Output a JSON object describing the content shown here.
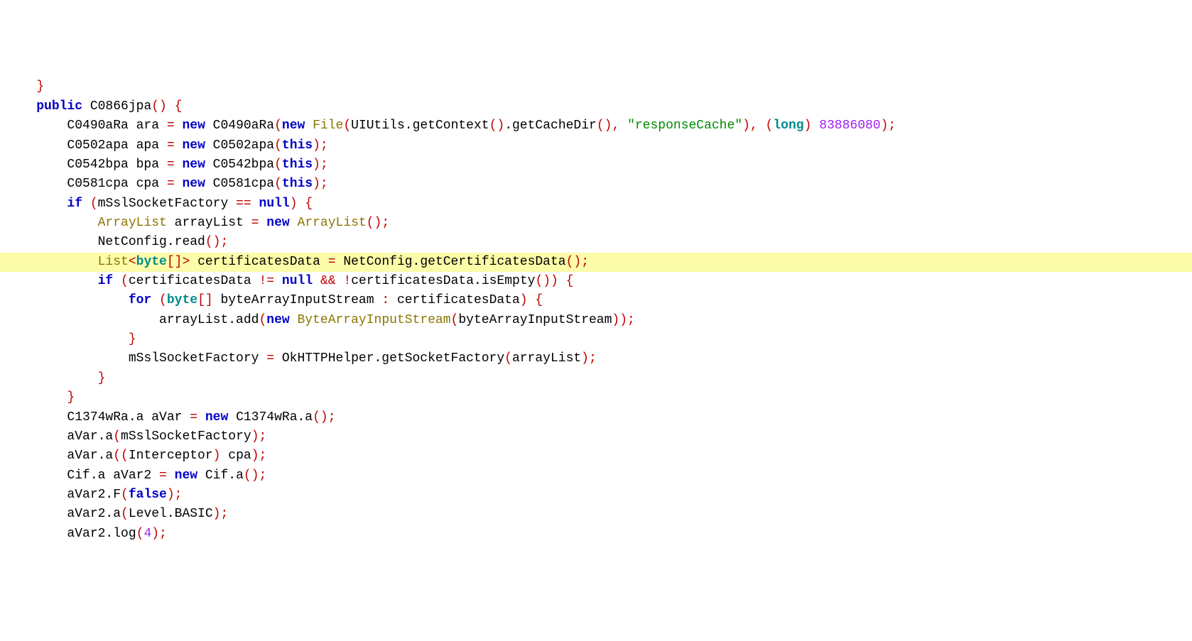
{
  "code": {
    "lines": [
      {
        "indent": 1,
        "highlighted": false,
        "tokens": [
          {
            "t": "brace",
            "v": "}"
          }
        ]
      },
      {
        "indent": 0,
        "highlighted": false,
        "tokens": []
      },
      {
        "indent": 1,
        "highlighted": false,
        "tokens": [
          {
            "t": "kw",
            "v": "public"
          },
          {
            "t": "plain",
            "v": " C0866jpa"
          },
          {
            "t": "paren",
            "v": "()"
          },
          {
            "t": "plain",
            "v": " "
          },
          {
            "t": "brace",
            "v": "{"
          }
        ]
      },
      {
        "indent": 2,
        "highlighted": false,
        "tokens": [
          {
            "t": "plain",
            "v": "C0490aRa ara "
          },
          {
            "t": "op",
            "v": "="
          },
          {
            "t": "plain",
            "v": " "
          },
          {
            "t": "newkw",
            "v": "new"
          },
          {
            "t": "plain",
            "v": " C0490aRa"
          },
          {
            "t": "paren",
            "v": "("
          },
          {
            "t": "newkw",
            "v": "new"
          },
          {
            "t": "plain",
            "v": " "
          },
          {
            "t": "type",
            "v": "File"
          },
          {
            "t": "paren",
            "v": "("
          },
          {
            "t": "plain",
            "v": "UIUtils.getContext"
          },
          {
            "t": "paren",
            "v": "()"
          },
          {
            "t": "plain",
            "v": ".getCacheDir"
          },
          {
            "t": "paren",
            "v": "()"
          },
          {
            "t": "op",
            "v": ","
          },
          {
            "t": "plain",
            "v": " "
          },
          {
            "t": "str",
            "v": "\"responseCache\""
          },
          {
            "t": "paren",
            "v": ")"
          },
          {
            "t": "op",
            "v": ","
          },
          {
            "t": "plain",
            "v": " "
          },
          {
            "t": "paren",
            "v": "("
          },
          {
            "t": "generic",
            "v": "long"
          },
          {
            "t": "paren",
            "v": ")"
          },
          {
            "t": "plain",
            "v": " "
          },
          {
            "t": "num",
            "v": "83886080"
          },
          {
            "t": "paren",
            "v": ")"
          },
          {
            "t": "semi",
            "v": ";"
          }
        ]
      },
      {
        "indent": 2,
        "highlighted": false,
        "tokens": [
          {
            "t": "plain",
            "v": "C0502apa apa "
          },
          {
            "t": "op",
            "v": "="
          },
          {
            "t": "plain",
            "v": " "
          },
          {
            "t": "newkw",
            "v": "new"
          },
          {
            "t": "plain",
            "v": " C0502apa"
          },
          {
            "t": "paren",
            "v": "("
          },
          {
            "t": "thiskw",
            "v": "this"
          },
          {
            "t": "paren",
            "v": ")"
          },
          {
            "t": "semi",
            "v": ";"
          }
        ]
      },
      {
        "indent": 2,
        "highlighted": false,
        "tokens": [
          {
            "t": "plain",
            "v": "C0542bpa bpa "
          },
          {
            "t": "op",
            "v": "="
          },
          {
            "t": "plain",
            "v": " "
          },
          {
            "t": "newkw",
            "v": "new"
          },
          {
            "t": "plain",
            "v": " C0542bpa"
          },
          {
            "t": "paren",
            "v": "("
          },
          {
            "t": "thiskw",
            "v": "this"
          },
          {
            "t": "paren",
            "v": ")"
          },
          {
            "t": "semi",
            "v": ";"
          }
        ]
      },
      {
        "indent": 2,
        "highlighted": false,
        "tokens": [
          {
            "t": "plain",
            "v": "C0581cpa cpa "
          },
          {
            "t": "op",
            "v": "="
          },
          {
            "t": "plain",
            "v": " "
          },
          {
            "t": "newkw",
            "v": "new"
          },
          {
            "t": "plain",
            "v": " C0581cpa"
          },
          {
            "t": "paren",
            "v": "("
          },
          {
            "t": "thiskw",
            "v": "this"
          },
          {
            "t": "paren",
            "v": ")"
          },
          {
            "t": "semi",
            "v": ";"
          }
        ]
      },
      {
        "indent": 2,
        "highlighted": false,
        "tokens": [
          {
            "t": "kw",
            "v": "if"
          },
          {
            "t": "plain",
            "v": " "
          },
          {
            "t": "paren",
            "v": "("
          },
          {
            "t": "plain",
            "v": "mSslSocketFactory "
          },
          {
            "t": "op",
            "v": "=="
          },
          {
            "t": "plain",
            "v": " "
          },
          {
            "t": "nullkw",
            "v": "null"
          },
          {
            "t": "paren",
            "v": ")"
          },
          {
            "t": "plain",
            "v": " "
          },
          {
            "t": "brace",
            "v": "{"
          }
        ]
      },
      {
        "indent": 3,
        "highlighted": false,
        "tokens": [
          {
            "t": "type",
            "v": "ArrayList"
          },
          {
            "t": "plain",
            "v": " arrayList "
          },
          {
            "t": "op",
            "v": "="
          },
          {
            "t": "plain",
            "v": " "
          },
          {
            "t": "newkw",
            "v": "new"
          },
          {
            "t": "plain",
            "v": " "
          },
          {
            "t": "type",
            "v": "ArrayList"
          },
          {
            "t": "paren",
            "v": "()"
          },
          {
            "t": "semi",
            "v": ";"
          }
        ]
      },
      {
        "indent": 3,
        "highlighted": false,
        "tokens": [
          {
            "t": "plain",
            "v": "NetConfig.read"
          },
          {
            "t": "paren",
            "v": "()"
          },
          {
            "t": "semi",
            "v": ";"
          }
        ]
      },
      {
        "indent": 3,
        "highlighted": true,
        "tokens": [
          {
            "t": "type",
            "v": "List"
          },
          {
            "t": "op",
            "v": "<"
          },
          {
            "t": "generic",
            "v": "byte"
          },
          {
            "t": "op",
            "v": "[]>"
          },
          {
            "t": "plain",
            "v": " certificatesData "
          },
          {
            "t": "op",
            "v": "="
          },
          {
            "t": "plain",
            "v": " NetConfig.getCertificatesData"
          },
          {
            "t": "paren",
            "v": "()"
          },
          {
            "t": "semi",
            "v": ";"
          }
        ]
      },
      {
        "indent": 3,
        "highlighted": false,
        "tokens": [
          {
            "t": "kw",
            "v": "if"
          },
          {
            "t": "plain",
            "v": " "
          },
          {
            "t": "paren",
            "v": "("
          },
          {
            "t": "plain",
            "v": "certificatesData "
          },
          {
            "t": "op",
            "v": "!="
          },
          {
            "t": "plain",
            "v": " "
          },
          {
            "t": "nullkw",
            "v": "null"
          },
          {
            "t": "plain",
            "v": " "
          },
          {
            "t": "op",
            "v": "&&"
          },
          {
            "t": "plain",
            "v": " "
          },
          {
            "t": "op",
            "v": "!"
          },
          {
            "t": "plain",
            "v": "certificatesData.isEmpty"
          },
          {
            "t": "paren",
            "v": "())"
          },
          {
            "t": "plain",
            "v": " "
          },
          {
            "t": "brace",
            "v": "{"
          }
        ]
      },
      {
        "indent": 4,
        "highlighted": false,
        "tokens": [
          {
            "t": "kw",
            "v": "for"
          },
          {
            "t": "plain",
            "v": " "
          },
          {
            "t": "paren",
            "v": "("
          },
          {
            "t": "generic",
            "v": "byte"
          },
          {
            "t": "op",
            "v": "[]"
          },
          {
            "t": "plain",
            "v": " byteArrayInputStream "
          },
          {
            "t": "op",
            "v": ":"
          },
          {
            "t": "plain",
            "v": " certificatesData"
          },
          {
            "t": "paren",
            "v": ")"
          },
          {
            "t": "plain",
            "v": " "
          },
          {
            "t": "brace",
            "v": "{"
          }
        ]
      },
      {
        "indent": 5,
        "highlighted": false,
        "tokens": [
          {
            "t": "plain",
            "v": "arrayList.add"
          },
          {
            "t": "paren",
            "v": "("
          },
          {
            "t": "newkw",
            "v": "new"
          },
          {
            "t": "plain",
            "v": " "
          },
          {
            "t": "type",
            "v": "ByteArrayInputStream"
          },
          {
            "t": "paren",
            "v": "("
          },
          {
            "t": "plain",
            "v": "byteArrayInputStream"
          },
          {
            "t": "paren",
            "v": "))"
          },
          {
            "t": "semi",
            "v": ";"
          }
        ]
      },
      {
        "indent": 4,
        "highlighted": false,
        "tokens": [
          {
            "t": "brace",
            "v": "}"
          }
        ]
      },
      {
        "indent": 4,
        "highlighted": false,
        "tokens": [
          {
            "t": "plain",
            "v": "mSslSocketFactory "
          },
          {
            "t": "op",
            "v": "="
          },
          {
            "t": "plain",
            "v": " OkHTTPHelper.getSocketFactory"
          },
          {
            "t": "paren",
            "v": "("
          },
          {
            "t": "plain",
            "v": "arrayList"
          },
          {
            "t": "paren",
            "v": ")"
          },
          {
            "t": "semi",
            "v": ";"
          }
        ]
      },
      {
        "indent": 3,
        "highlighted": false,
        "tokens": [
          {
            "t": "brace",
            "v": "}"
          }
        ]
      },
      {
        "indent": 2,
        "highlighted": false,
        "tokens": [
          {
            "t": "brace",
            "v": "}"
          }
        ]
      },
      {
        "indent": 2,
        "highlighted": false,
        "tokens": [
          {
            "t": "plain",
            "v": "C1374wRa.a aVar "
          },
          {
            "t": "op",
            "v": "="
          },
          {
            "t": "plain",
            "v": " "
          },
          {
            "t": "newkw",
            "v": "new"
          },
          {
            "t": "plain",
            "v": " C1374wRa.a"
          },
          {
            "t": "paren",
            "v": "()"
          },
          {
            "t": "semi",
            "v": ";"
          }
        ]
      },
      {
        "indent": 2,
        "highlighted": false,
        "tokens": [
          {
            "t": "plain",
            "v": "aVar.a"
          },
          {
            "t": "paren",
            "v": "("
          },
          {
            "t": "plain",
            "v": "mSslSocketFactory"
          },
          {
            "t": "paren",
            "v": ")"
          },
          {
            "t": "semi",
            "v": ";"
          }
        ]
      },
      {
        "indent": 2,
        "highlighted": false,
        "tokens": [
          {
            "t": "plain",
            "v": "aVar.a"
          },
          {
            "t": "paren",
            "v": "(("
          },
          {
            "t": "plain",
            "v": "Interceptor"
          },
          {
            "t": "paren",
            "v": ")"
          },
          {
            "t": "plain",
            "v": " cpa"
          },
          {
            "t": "paren",
            "v": ")"
          },
          {
            "t": "semi",
            "v": ";"
          }
        ]
      },
      {
        "indent": 2,
        "highlighted": false,
        "tokens": [
          {
            "t": "plain",
            "v": "Cif.a aVar2 "
          },
          {
            "t": "op",
            "v": "="
          },
          {
            "t": "plain",
            "v": " "
          },
          {
            "t": "newkw",
            "v": "new"
          },
          {
            "t": "plain",
            "v": " Cif.a"
          },
          {
            "t": "paren",
            "v": "()"
          },
          {
            "t": "semi",
            "v": ";"
          }
        ]
      },
      {
        "indent": 2,
        "highlighted": false,
        "tokens": [
          {
            "t": "plain",
            "v": "aVar2.F"
          },
          {
            "t": "paren",
            "v": "("
          },
          {
            "t": "kw",
            "v": "false"
          },
          {
            "t": "paren",
            "v": ")"
          },
          {
            "t": "semi",
            "v": ";"
          }
        ]
      },
      {
        "indent": 2,
        "highlighted": false,
        "tokens": [
          {
            "t": "plain",
            "v": "aVar2.a"
          },
          {
            "t": "paren",
            "v": "("
          },
          {
            "t": "plain",
            "v": "Level.BASIC"
          },
          {
            "t": "paren",
            "v": ")"
          },
          {
            "t": "semi",
            "v": ";"
          }
        ]
      },
      {
        "indent": 2,
        "highlighted": false,
        "tokens": [
          {
            "t": "plain",
            "v": "aVar2.log"
          },
          {
            "t": "paren",
            "v": "("
          },
          {
            "t": "num",
            "v": "4"
          },
          {
            "t": "paren",
            "v": ")"
          },
          {
            "t": "semi",
            "v": ";"
          }
        ]
      }
    ],
    "indentUnit": "    "
  }
}
